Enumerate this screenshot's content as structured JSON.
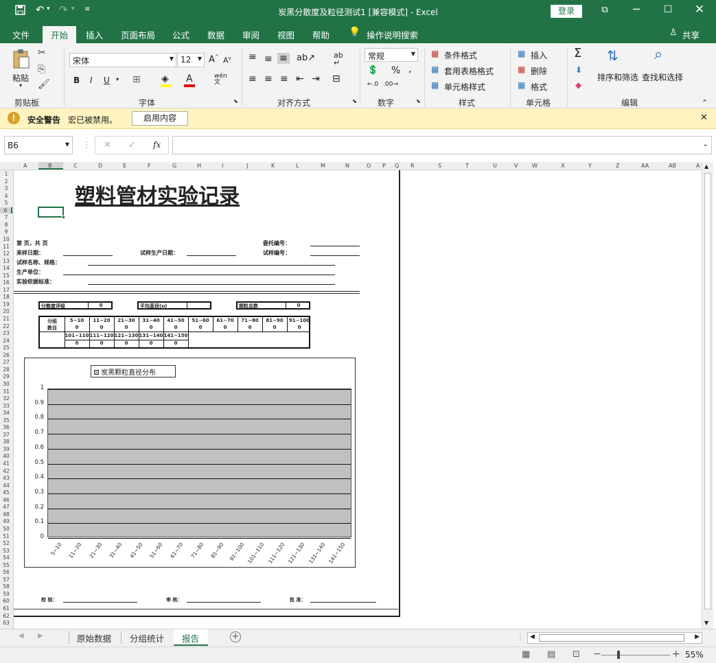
{
  "window": {
    "title": "炭黑分散度及粒径测试1  [兼容模式]  -  Excel",
    "login_label": "登录"
  },
  "ribbon_tabs": [
    "文件",
    "开始",
    "插入",
    "页面布局",
    "公式",
    "数据",
    "审阅",
    "视图",
    "帮助"
  ],
  "tell_me": "操作说明搜索",
  "share_label": "共享",
  "ribbon": {
    "paste_label": "粘贴",
    "clipboard_label": "剪贴板",
    "font_name": "宋体",
    "font_size": "12",
    "font_label": "字体",
    "align_label": "对齐方式",
    "number_format": "常规",
    "number_label": "数字",
    "cond_format": "条件格式",
    "table_format": "套用表格格式",
    "cell_style": "单元格样式",
    "styles_label": "样式",
    "insert_label": "插入",
    "delete_label": "删除",
    "format_label": "格式",
    "cells_label": "单元格",
    "sort_filter": "排序和筛选",
    "find_select": "查找和选择",
    "editing_label": "编辑",
    "bold": "B",
    "italic": "I",
    "underline": "U",
    "pinyin": "wén"
  },
  "security": {
    "title": "安全警告",
    "message": "宏已被禁用。",
    "button": "启用内容"
  },
  "formula": {
    "name_box": "B6",
    "fx": "fx",
    "value": ""
  },
  "columns": [
    "A",
    "B",
    "C",
    "D",
    "E",
    "F",
    "G",
    "H",
    "I",
    "J",
    "K",
    "L",
    "M",
    "N",
    "O",
    "P",
    "Q",
    "R",
    "S",
    "T",
    "U",
    "V",
    "W",
    "X",
    "Y",
    "Z",
    "AA",
    "AB",
    "A"
  ],
  "rows": [
    "1",
    "2",
    "3",
    "4",
    "5",
    "6",
    "7",
    "8",
    "9",
    "10",
    "11",
    "12",
    "13",
    "14",
    "15",
    "16",
    "17",
    "18",
    "19",
    "20",
    "21",
    "22",
    "23",
    "24",
    "25",
    "26",
    "27",
    "28",
    "29",
    "30",
    "31",
    "32",
    "33",
    "34",
    "35",
    "36",
    "37",
    "38",
    "39",
    "40",
    "41",
    "42",
    "43",
    "44",
    "45",
    "46",
    "47",
    "48",
    "49",
    "50",
    "51",
    "52",
    "53",
    "54",
    "55",
    "56",
    "57",
    "58",
    "59",
    "60",
    "61",
    "62",
    "63"
  ],
  "report": {
    "title": "塑料管材实验记录",
    "page_info": "第    页，共    页",
    "entrust_no": "委托编号：",
    "sample_date": "来样日期：",
    "produce_date": "试样生产日期：",
    "sample_no": "试样编号：",
    "sample_name": "试样名称、规格：",
    "producer": "生产单位：",
    "standard": "实验依据标准：",
    "dispersion_label": "分散度评级",
    "dispersion_value": "0",
    "avg_diameter_label": "平均直径(u)",
    "avg_diameter_value": "",
    "particle_total_label": "颗粒总数",
    "particle_total_value": "0",
    "group_label": "分组",
    "count_label": "数目",
    "groups_row1": [
      "5~10",
      "11~20",
      "21~30",
      "31~40",
      "41~50",
      "51~60",
      "61~70",
      "71~80",
      "81~90",
      "91~100"
    ],
    "counts_row1": [
      "0",
      "0",
      "0",
      "0",
      "0",
      "0",
      "0",
      "0",
      "0",
      "0"
    ],
    "groups_row2": [
      "101~110",
      "111~120",
      "121~130",
      "131~140",
      "141~150"
    ],
    "counts_row2": [
      "0",
      "0",
      "0",
      "0",
      "0"
    ],
    "check_label": "检  验：",
    "review_label": "审  核：",
    "approve_label": "批  准："
  },
  "chart_data": {
    "type": "bar",
    "title": "",
    "legend": "炭黑颗粒直径分布",
    "categories": [
      "5~10",
      "11~20",
      "21~30",
      "31~40",
      "41~50",
      "51~60",
      "61~70",
      "71~80",
      "81~90",
      "91~100",
      "101~110",
      "111~120",
      "121~130",
      "131~140",
      "141~150"
    ],
    "values": [
      0,
      0,
      0,
      0,
      0,
      0,
      0,
      0,
      0,
      0,
      0,
      0,
      0,
      0,
      0
    ],
    "yticks": [
      "1",
      "0.9",
      "0.8",
      "0.7",
      "0.6",
      "0.5",
      "0.4",
      "0.3",
      "0.2",
      "0.1",
      "0"
    ],
    "ylim": [
      0,
      1
    ],
    "grid": true,
    "legend_position": "top",
    "plot_color": "#c0c0c0"
  },
  "sheets": [
    "原始数据",
    "分组统计",
    "报告"
  ],
  "active_sheet": "报告",
  "zoom": "55%"
}
